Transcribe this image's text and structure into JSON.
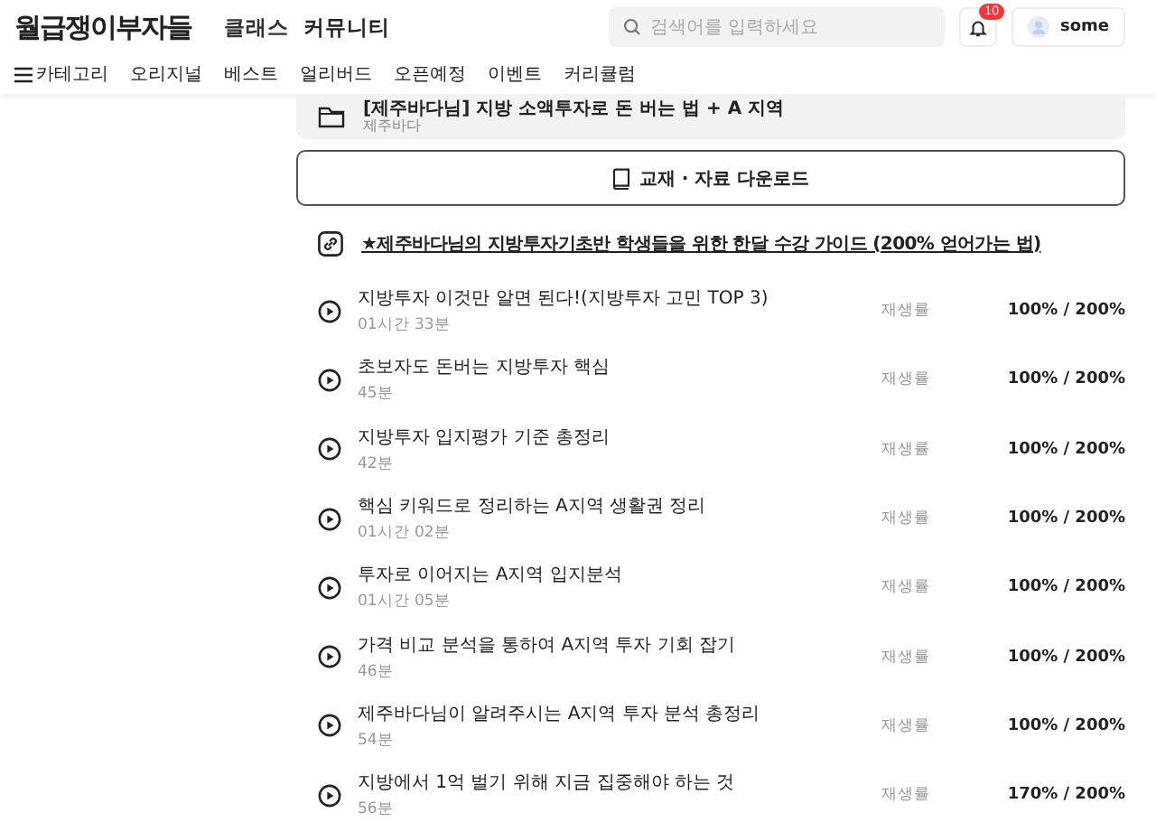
{
  "header": {
    "logo": "월급쟁이부자들",
    "menu": [
      "클래스",
      "커뮤니티"
    ],
    "search": {
      "placeholder": "검색어를 입력하세요"
    },
    "notifications": {
      "count": "10"
    },
    "user": {
      "name": "some"
    }
  },
  "nav": {
    "category": "카테고리",
    "items": [
      "오리지널",
      "베스트",
      "얼리버드",
      "오픈예정",
      "이벤트",
      "커리큘럼"
    ]
  },
  "course": {
    "title": "[제주바다님] 지방 소액투자로 돈 버는 법 + A 지역",
    "author": "제주바다"
  },
  "download": {
    "label": "교재 · 자료 다운로드"
  },
  "guide": {
    "label": "★제주바다님의 지방투자기초반 학생들을 위한 한달 수강 가이드 (200% 얻어가는 법)"
  },
  "lessons": [
    {
      "title": "지방투자 이것만 알면 된다!(지방투자 고민 TOP 3)",
      "duration": "01시간 33분",
      "rate_label": "재생률",
      "rate": "100% / 200%"
    },
    {
      "title": "초보자도 돈버는 지방투자 핵심",
      "duration": "45분",
      "rate_label": "재생률",
      "rate": "100% / 200%"
    },
    {
      "title": "지방투자 입지평가 기준 총정리",
      "duration": "42분",
      "rate_label": "재생률",
      "rate": "100% / 200%"
    },
    {
      "title": "핵심 키워드로 정리하는 A지역 생활권 정리",
      "duration": "01시간 02분",
      "rate_label": "재생률",
      "rate": "100% / 200%"
    },
    {
      "title": "투자로 이어지는 A지역 입지분석",
      "duration": "01시간 05분",
      "rate_label": "재생률",
      "rate": "100% / 200%"
    },
    {
      "title": "가격 비교 분석을 통하여 A지역 투자 기회 잡기",
      "duration": "46분",
      "rate_label": "재생률",
      "rate": "100% / 200%"
    },
    {
      "title": "제주바다님이 알려주시는 A지역 투자 분석 총정리",
      "duration": "54분",
      "rate_label": "재생률",
      "rate": "100% / 200%"
    },
    {
      "title": "지방에서 1억 벌기 위해 지금 집중해야 하는 것",
      "duration": "56분",
      "rate_label": "재생률",
      "rate": "170% / 200%"
    }
  ]
}
